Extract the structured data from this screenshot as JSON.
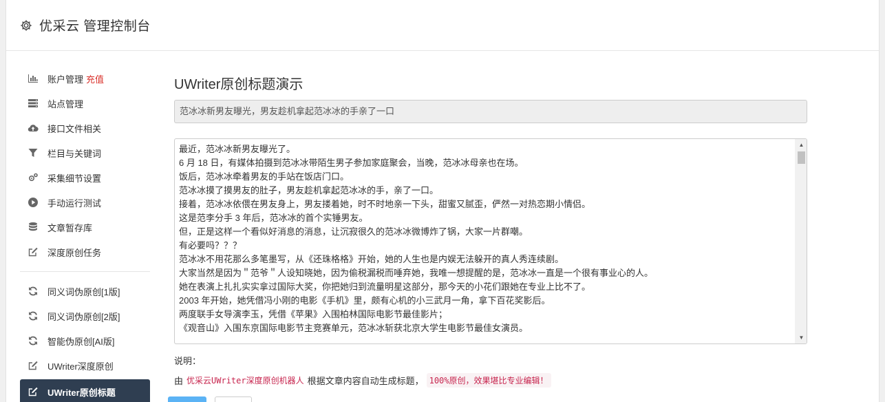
{
  "header": {
    "title": "优采云 管理控制台",
    "icon": "gear-icon"
  },
  "sidebar": {
    "items": [
      {
        "label": "账户管理",
        "badge": "充值",
        "icon": "bar-chart-icon"
      },
      {
        "label": "站点管理",
        "icon": "server-icon"
      },
      {
        "label": "接口文件相关",
        "icon": "cloud-upload-icon"
      },
      {
        "label": "栏目与关键词",
        "icon": "filter-icon"
      },
      {
        "label": "采集细节设置",
        "icon": "gears-icon"
      },
      {
        "label": "手动运行测试",
        "icon": "play-circle-icon"
      },
      {
        "label": "文章暂存库",
        "icon": "database-icon"
      },
      {
        "label": "深度原创任务",
        "icon": "edit-icon"
      }
    ],
    "items2": [
      {
        "label": "同义词伪原创[1版]",
        "icon": "refresh-icon"
      },
      {
        "label": "同义词伪原创[2版]",
        "icon": "refresh-icon"
      },
      {
        "label": "智能伪原创[AI版]",
        "icon": "refresh-icon"
      },
      {
        "label": "UWriter深度原创",
        "icon": "edit-icon"
      },
      {
        "label": "UWriter原创标题",
        "icon": "edit-icon",
        "active": true
      }
    ]
  },
  "main": {
    "page_title": "UWriter原创标题演示",
    "generated_title": "范冰冰新男友曝光，男友趁机拿起范冰冰的手亲了一口",
    "article_lines": [
      "最近，范冰冰新男友曝光了。",
      "6 月 18 日，有媒体拍摄到范冰冰带陌生男子参加家庭聚会，当晚，范冰冰母亲也在场。",
      "饭后，范冰冰牵着男友的手站在饭店门口。",
      "范冰冰摸了摸男友的肚子，男友趁机拿起范冰冰的手，亲了一口。",
      "接着，范冰冰依偎在男友身上，男友搂着她，时不时地亲一下头，甜蜜又腻歪，俨然一对热恋期小情侣。",
      "这是范李分手 3 年后，范冰冰的首个实锤男友。",
      "但，正是这样一个看似好消息的消息，让沉寂很久的范冰冰微博炸了锅，大家一片群嘲。",
      "有必要吗？？？",
      "范冰冰不用花那么多笔墨写，从《还珠格格》开始，她的人生也是内娱无法躲开的真人秀连续剧。",
      "大家当然是因为＂范爷＂人设知晓她，因为偷税漏税而唾弃她，我唯一想提醒的是，范冰冰一直是一个很有事业心的人。",
      "她在表演上扎扎实实拿过国际大奖，你把她归到流量明星这部分，那今天的小花们跟她在专业上比不了。",
      "2003 年开始，她凭借冯小刚的电影《手机》里，颇有心机的小三武月一角，拿下百花奖影后。",
      "两度联手女导演李玉，凭借《苹果》入围柏林国际电影节最佳影片；",
      "《观音山》入围东京国际电影节主竞赛单元，范冰冰斩获北京大学生电影节最佳女演员。"
    ],
    "note_label": "说明：",
    "note_prefix": "由",
    "note_robot": "优采云UWriter深度原创机器人",
    "note_middle": "根据文章内容自动生成标题，",
    "note_highlight": "100%原创，效果堪比专业编辑！"
  },
  "colors": {
    "active_bg": "#2f3e51",
    "accent_red": "#d9312b",
    "code_pink": "#c7254e",
    "primary_button": "#5bb3f5"
  }
}
